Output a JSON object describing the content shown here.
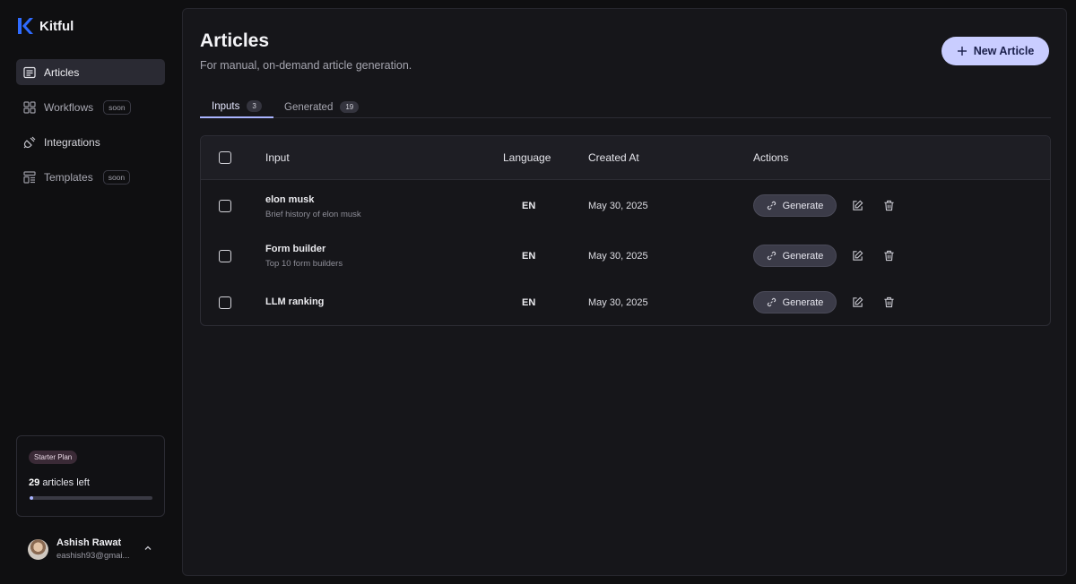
{
  "app": {
    "name": "Kitful"
  },
  "sidebar": {
    "items": [
      {
        "label": "Articles",
        "icon": "articles-icon",
        "badge": ""
      },
      {
        "label": "Workflows",
        "icon": "workflows-icon",
        "badge": "soon"
      },
      {
        "label": "Integrations",
        "icon": "integrations-icon",
        "badge": ""
      },
      {
        "label": "Templates",
        "icon": "templates-icon",
        "badge": "soon"
      }
    ]
  },
  "plan": {
    "name": "Starter Plan",
    "articles_left": "29",
    "articles_left_label": "articles left",
    "progress_fraction": 0.03
  },
  "user": {
    "name": "Ashish Rawat",
    "email": "eashish93@gmai..."
  },
  "page": {
    "title": "Articles",
    "subtitle": "For manual, on-demand article generation.",
    "new_button": "New Article"
  },
  "tabs": [
    {
      "label": "Inputs",
      "count": "3"
    },
    {
      "label": "Generated",
      "count": "19"
    }
  ],
  "table": {
    "headers": {
      "input": "Input",
      "language": "Language",
      "created_at": "Created At",
      "actions": "Actions"
    },
    "rows": [
      {
        "title": "elon musk",
        "subtitle": "Brief history of elon musk",
        "language": "EN",
        "created_at": "May 30, 2025",
        "action": "Generate"
      },
      {
        "title": "Form builder",
        "subtitle": "Top 10 form builders",
        "language": "EN",
        "created_at": "May 30, 2025",
        "action": "Generate"
      },
      {
        "title": "LLM ranking",
        "subtitle": "",
        "language": "EN",
        "created_at": "May 30, 2025",
        "action": "Generate"
      }
    ]
  },
  "colors": {
    "accent": "#a9b4ff",
    "button": "#c9cdff",
    "background": "#0f0f11",
    "panel": "#16161a"
  }
}
